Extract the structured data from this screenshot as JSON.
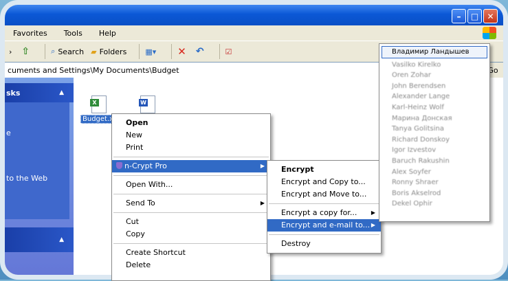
{
  "menubar": {
    "favorites": "Favorites",
    "tools": "Tools",
    "help": "Help"
  },
  "toolbar": {
    "search": "Search",
    "folders": "Folders"
  },
  "address": {
    "path": "cuments and Settings\\My Documents\\Budget",
    "go": "Go"
  },
  "leftpane": {
    "header": "sks",
    "item1": "e",
    "item2": "to the Web"
  },
  "files": {
    "xls_label": "Budget.xl"
  },
  "context_menu": {
    "open": "Open",
    "new": "New",
    "print": "Print",
    "ncrypt": "n-Crypt Pro",
    "open_with": "Open With...",
    "send_to": "Send To",
    "cut": "Cut",
    "copy": "Copy",
    "create_shortcut": "Create Shortcut",
    "delete": "Delete"
  },
  "submenu": {
    "encrypt": "Encrypt",
    "encrypt_copy": "Encrypt and Copy to...",
    "encrypt_move": "Encrypt and Move to...",
    "encrypt_copy_for": "Encrypt a copy for...",
    "encrypt_email": "Encrypt and e-mail to...",
    "destroy": "Destroy"
  },
  "recipients": [
    "Владимир Ландышев",
    "Vasilko Kirelko",
    "Oren Zohar",
    "John Berendsen",
    "Alexander Lange",
    "Karl-Heinz Wolf",
    "Марина Донская",
    "Tanya Golitsina",
    "Richard Donskoy",
    "Igor Izvestov",
    "Baruch Rakushin",
    "Alex Soyfer",
    "Ronny Shraer",
    "Boris Akselrod",
    "Dekel Ophir"
  ]
}
